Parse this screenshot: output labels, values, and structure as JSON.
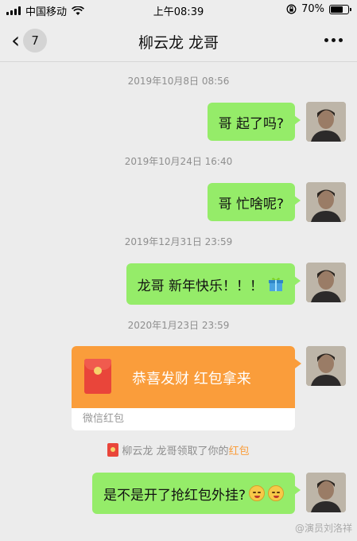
{
  "status_bar": {
    "carrier": "中国移动",
    "time": "上午08:39",
    "battery": "70%",
    "battery_level": 0.7
  },
  "nav": {
    "back_count": "7",
    "title": "柳云龙 龙哥",
    "more_icon": "more-dots-icon"
  },
  "messages": [
    {
      "timestamp": "2019年10月8日 08:56",
      "text": "哥 起了吗?"
    },
    {
      "timestamp": "2019年10月24日 16:40",
      "text": "哥 忙啥呢?"
    },
    {
      "timestamp": "2019年12月31日 23:59",
      "text": "龙哥 新年快乐！！！",
      "icon": "gift-icon"
    },
    {
      "timestamp": "2020年1月23日 23:59"
    }
  ],
  "red_packet": {
    "greeting": "恭喜发财 红包拿来",
    "footer": "微信红包",
    "accent": "#fa9d3b"
  },
  "notice": {
    "prefix": "柳云龙 龙哥领取了你的",
    "link": "红包"
  },
  "last_message": {
    "text": "是不是开了抢红包外挂?",
    "emoji_icon": "blushing-emoji-icon"
  },
  "watermark": "@演员刘洛祥",
  "colors": {
    "bubble": "#95ec69",
    "background": "#ececec",
    "red_packet": "#fa9d3b"
  }
}
